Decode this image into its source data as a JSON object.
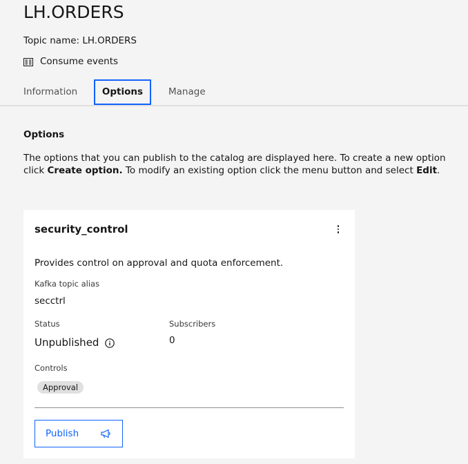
{
  "page": {
    "title": "LH.ORDERS",
    "topic_name": "Topic name: LH.ORDERS",
    "consume_label": "Consume events"
  },
  "tabs": [
    {
      "label": "Information",
      "selected": false
    },
    {
      "label": "Options",
      "selected": true
    },
    {
      "label": "Manage",
      "selected": false
    }
  ],
  "section": {
    "title": "Options",
    "desc_part1": "The options that you can publish to the catalog are displayed here. To create a new option click ",
    "desc_bold1": "Create option.",
    "desc_part2": " To modify an existing option click the menu button and select ",
    "desc_bold2": "Edit",
    "desc_part3": "."
  },
  "card": {
    "title": "security_control",
    "description": "Provides control on approval and quota enforcement.",
    "alias_label": "Kafka topic alias",
    "alias_value": "secctrl",
    "status_label": "Status",
    "status_value": "Unpublished",
    "subscribers_label": "Subscribers",
    "subscribers_value": "0",
    "controls_label": "Controls",
    "controls": [
      "Approval"
    ],
    "publish_label": "Publish"
  },
  "icons": {
    "consume": "list-document-icon",
    "overflow": "overflow-menu-vertical-icon",
    "status_info": "information-icon",
    "publish": "megaphone-icon"
  },
  "colors": {
    "accent": "#0f62fe",
    "background": "#f4f4f4",
    "card": "#ffffff",
    "tag": "#e0e0e0"
  }
}
